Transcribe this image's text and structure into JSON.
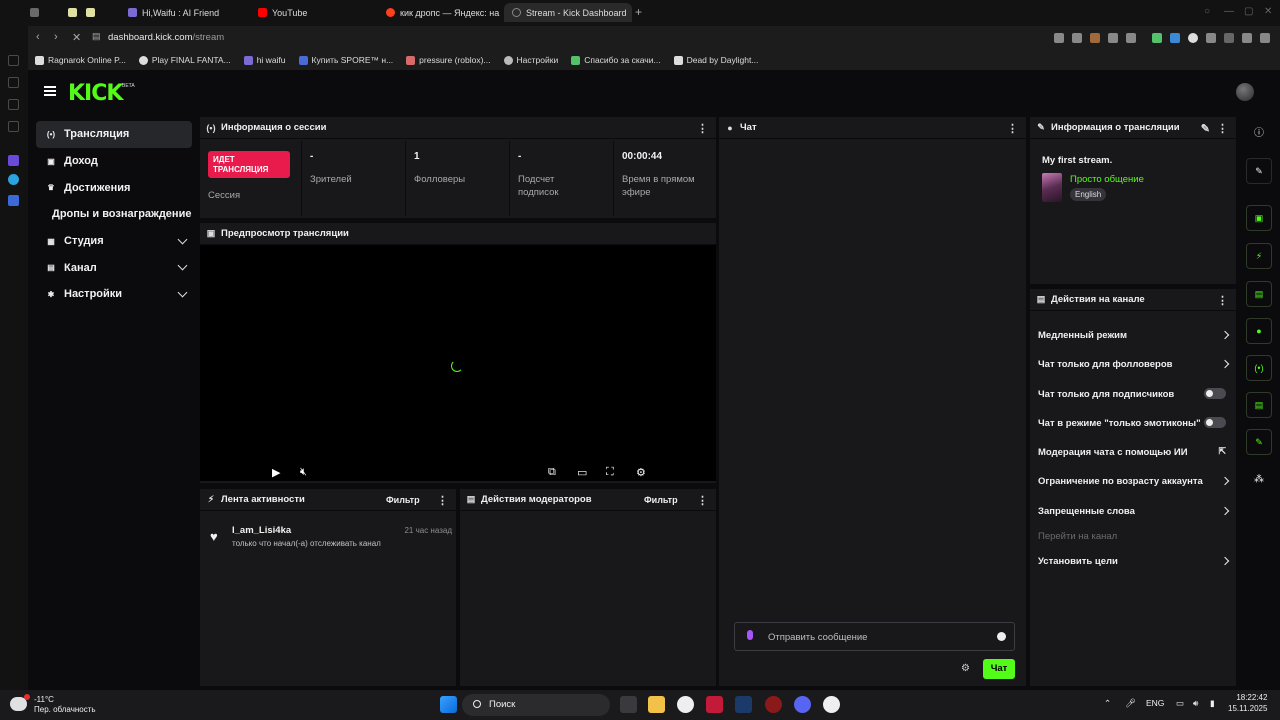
{
  "browser": {
    "tabs": [
      {
        "label": "",
        "color": "#6a6a6a"
      },
      {
        "label": "",
        "color": "#e0e0a0"
      },
      {
        "label": "",
        "color": "#e0e0a0"
      },
      {
        "label": "Hi,Waifu : AI Friend",
        "color": "#7a6cd4"
      },
      {
        "label": "YouTube",
        "color": "#ff0000"
      },
      {
        "label": "кик дропс — Яндекс: на",
        "color": "#fc3f1d"
      },
      {
        "label": "Stream - Kick Dashboard",
        "color": "#777777"
      }
    ],
    "url_host": "dashboard.kick.com",
    "url_path": "/stream",
    "bookmarks": [
      {
        "label": "Ragnarok Online P...",
        "color": "#dddddd"
      },
      {
        "label": "Play FINAL FANTA...",
        "color": "#dddddd"
      },
      {
        "label": "hi waifu",
        "color": "#7a6cd4"
      },
      {
        "label": "Купить SPORE™ н...",
        "color": "#4a6ad8"
      },
      {
        "label": "pressure (roblox)...",
        "color": "#d86a6a"
      },
      {
        "label": "Настройки",
        "color": "#bbbbbb"
      },
      {
        "label": "Спасибо за скачи...",
        "color": "#53c26a"
      },
      {
        "label": "Dead by Daylight...",
        "color": "#dddddd"
      }
    ]
  },
  "app": {
    "logo": "KICK",
    "logo_beta": "BETA",
    "accent": "#53fc18",
    "sidebar": [
      {
        "label": "Трансляция",
        "icon": "broadcast-icon",
        "glyph": "(•)",
        "active": true,
        "chevron": false,
        "sub": false
      },
      {
        "label": "Доход",
        "icon": "money-icon",
        "glyph": "▣",
        "active": false,
        "chevron": false,
        "sub": false
      },
      {
        "label": "Достижения",
        "icon": "trophy-icon",
        "glyph": "♛",
        "active": false,
        "chevron": false,
        "sub": false
      },
      {
        "label": "Дропы и вознаграждение",
        "icon": "",
        "glyph": "",
        "active": false,
        "chevron": false,
        "sub": true
      },
      {
        "label": "Студия",
        "icon": "studio-icon",
        "glyph": "▦",
        "active": false,
        "chevron": true,
        "sub": false
      },
      {
        "label": "Канал",
        "icon": "channel-icon",
        "glyph": "▤",
        "active": false,
        "chevron": true,
        "sub": false
      },
      {
        "label": "Настройки",
        "icon": "gear-icon",
        "glyph": "✱",
        "active": false,
        "chevron": true,
        "sub": false
      }
    ],
    "session": {
      "title": "Информация о сессии",
      "live_badge": "ИДЕТ ТРАНСЛЯЦИЯ",
      "session_label": "Сессия",
      "stats": [
        {
          "value": "-",
          "label": "Зрителей"
        },
        {
          "value": "1",
          "label": "Фолловеры"
        },
        {
          "value": "-",
          "label": "Подсчет подписок"
        },
        {
          "value": "00:00:44",
          "label": "Время в прямом эфире"
        }
      ]
    },
    "preview": {
      "title": "Предпросмотр трансляции"
    },
    "activity": {
      "title": "Лента активности",
      "filter": "Фильтр",
      "items": [
        {
          "user": "I_am_Lisi4ka",
          "time": "21 час назад",
          "text": "только что начал(-а) отслеживать канал"
        }
      ]
    },
    "moderators": {
      "title": "Действия модераторов",
      "filter": "Фильтр"
    },
    "chat": {
      "title": "Чат",
      "placeholder": "Отправить сообщение",
      "send_label": "Чат"
    },
    "stream_info": {
      "title": "Информация о трансляции",
      "stream_title": "My first stream.",
      "category": "Просто общение",
      "language": "English"
    },
    "channel_actions": {
      "title": "Действия на канале",
      "items": [
        {
          "label": "Медленный режим",
          "kind": "chevron"
        },
        {
          "label": "Чат только для фолловеров",
          "kind": "chevron"
        },
        {
          "label": "Чат только для подписчиков",
          "kind": "toggle"
        },
        {
          "label": "Чат в режиме \"только эмотиконы\"",
          "kind": "toggle"
        },
        {
          "label": "Модерация чата с помощью ИИ",
          "kind": "external"
        },
        {
          "label": "Ограничение по возрасту аккаунта",
          "kind": "chevron"
        },
        {
          "label": "Запрещенные слова",
          "kind": "chevron"
        },
        {
          "label": "Перейти на канал",
          "kind": "disabled"
        },
        {
          "label": "Установить цели",
          "kind": "chevron"
        }
      ]
    }
  },
  "taskbar": {
    "weather_temp": "-11°C",
    "weather_desc": "Пер. облачность",
    "search": "Поиск",
    "lang": "ENG",
    "time": "18:22:42",
    "date": "15.11.2025"
  }
}
